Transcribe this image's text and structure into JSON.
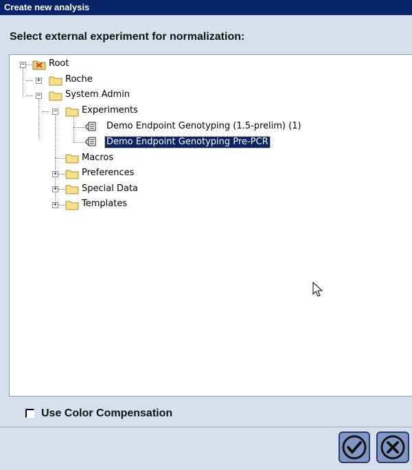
{
  "window": {
    "title": "Create new analysis"
  },
  "dialog": {
    "heading": "Select external experiment for normalization:"
  },
  "tree": {
    "root": "Root",
    "roche": "Roche",
    "system_admin": "System Admin",
    "experiments": "Experiments",
    "exp1": "Demo Endpoint Genotyping (1.5-prelim) (1)",
    "exp2": "Demo Endpoint Genotyping Pre-PCR",
    "macros": "Macros",
    "preferences": "Preferences",
    "special_data": "Special Data",
    "templates": "Templates",
    "selected": "Demo Endpoint Genotyping Pre-PCR"
  },
  "options": {
    "color_compensation_label": "Use Color Compensation",
    "color_compensation_checked": false
  },
  "buttons": {
    "ok_icon": "checkmark-icon",
    "cancel_icon": "x-circle-icon"
  },
  "colors": {
    "title_bar": "#0a246a",
    "dialog_bg": "#d6dfec",
    "selection": "#0a246a",
    "button_fill": "#7e97c4"
  }
}
